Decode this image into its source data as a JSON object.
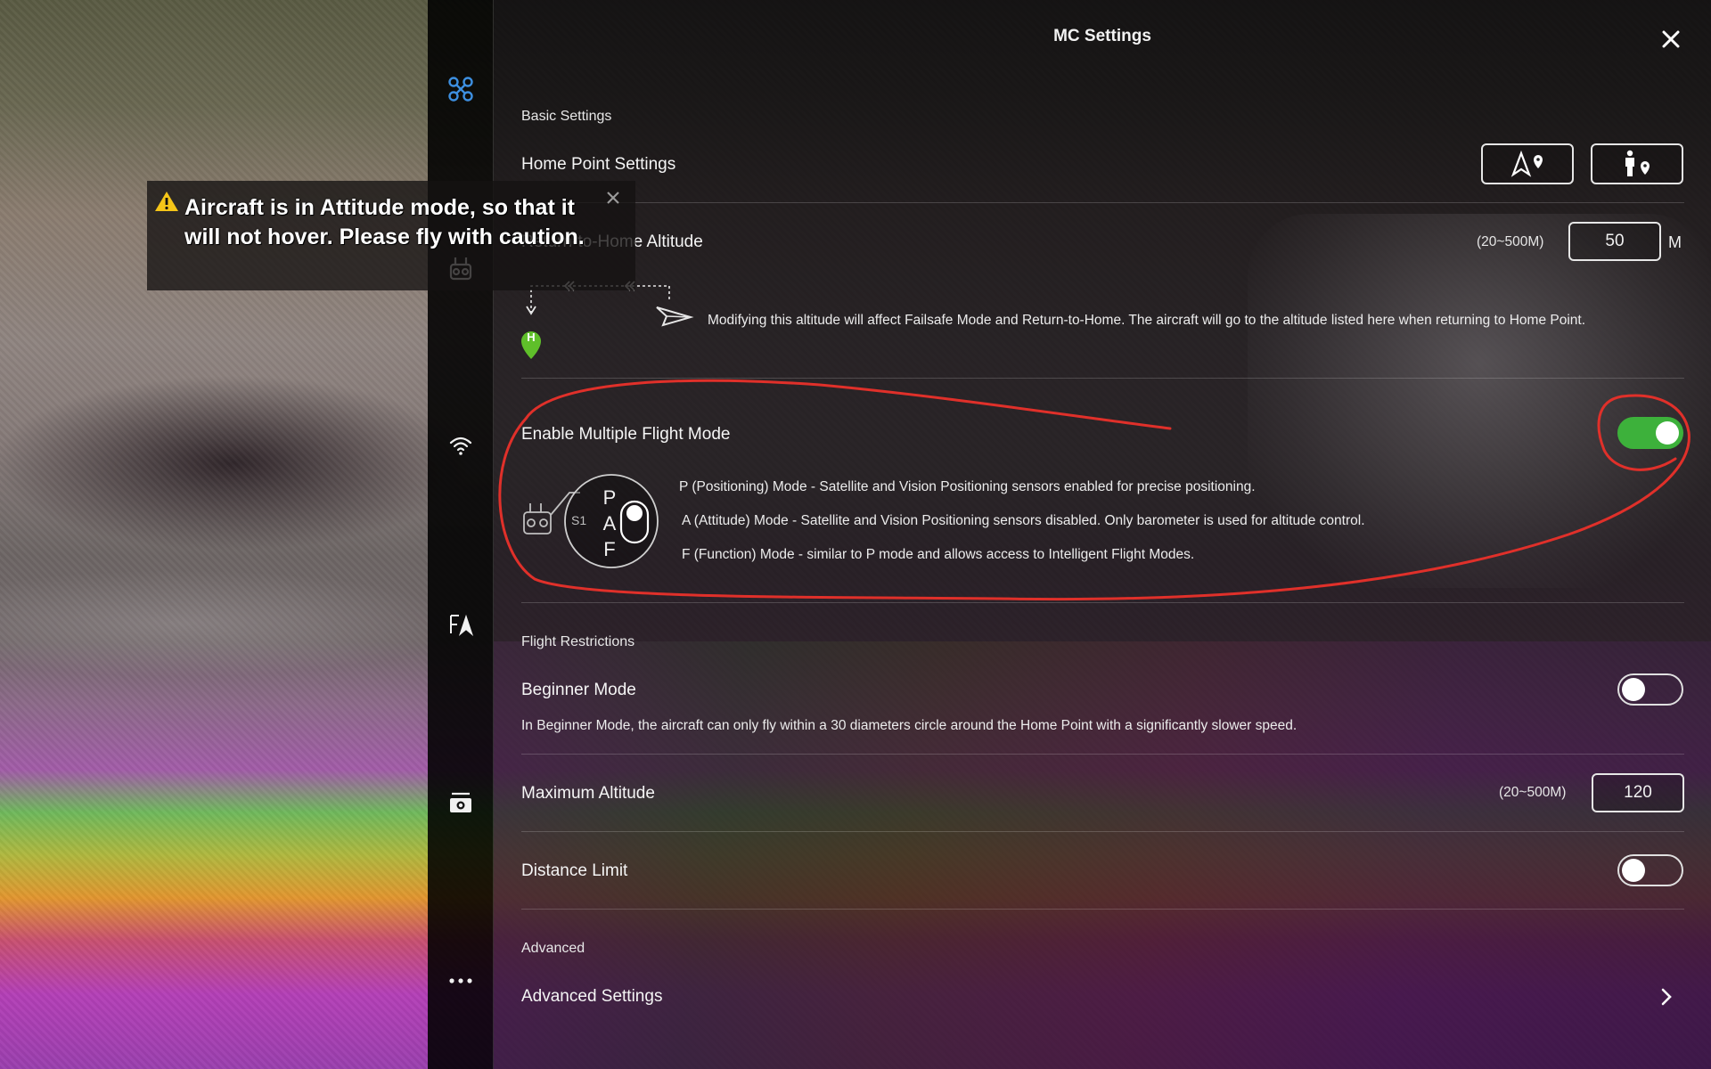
{
  "header": {
    "title": "MC Settings"
  },
  "warning": {
    "message": "Aircraft is in Attitude mode, so that it will not hover. Please fly with caution."
  },
  "sidebar": {
    "items": [
      {
        "icon": "aircraft-icon",
        "active": true
      },
      {
        "icon": "remote-controller-icon"
      },
      {
        "icon": "wifi-signal-icon"
      },
      {
        "icon": "flight-map-icon"
      },
      {
        "icon": "camera-icon"
      },
      {
        "icon": "more-icon"
      }
    ]
  },
  "basic": {
    "section_label": "Basic Settings",
    "home_point": {
      "label": "Home Point Settings"
    },
    "rth": {
      "label": "Return-to-Home Altitude",
      "range": "(20~500M)",
      "value": "50",
      "unit": "M",
      "diagram_home_letter": "H",
      "description": "Modifying this altitude will affect Failsafe Mode and Return-to-Home. The aircraft will go to the altitude listed here when returning to Home Point."
    },
    "multi_mode": {
      "label": "Enable Multiple Flight Mode",
      "enabled": true,
      "switch_label": "S1",
      "switch_letters": [
        "P",
        "A",
        "F"
      ],
      "modes": [
        "P (Positioning) Mode - Satellite and Vision Positioning sensors enabled for precise positioning.",
        "A (Attitude) Mode - Satellite and Vision Positioning sensors disabled. Only barometer is used for altitude control.",
        "F (Function) Mode - similar to P mode and allows access to Intelligent Flight Modes."
      ]
    }
  },
  "restrictions": {
    "section_label": "Flight Restrictions",
    "beginner": {
      "label": "Beginner Mode",
      "enabled": false,
      "description": "In Beginner Mode, the aircraft can only fly within a 30 diameters circle around the Home Point with a significantly slower speed."
    },
    "max_altitude": {
      "label": "Maximum Altitude",
      "range": "(20~500M)",
      "value": "120"
    },
    "distance_limit": {
      "label": "Distance Limit",
      "enabled": false
    }
  },
  "advanced": {
    "section_label": "Advanced",
    "settings": {
      "label": "Advanced Settings"
    }
  },
  "colors": {
    "toggle_on": "#3db13b",
    "home_marker": "#5fbf2a",
    "annotation": "#e0302a",
    "accent_blue": "#3d8fe0"
  }
}
